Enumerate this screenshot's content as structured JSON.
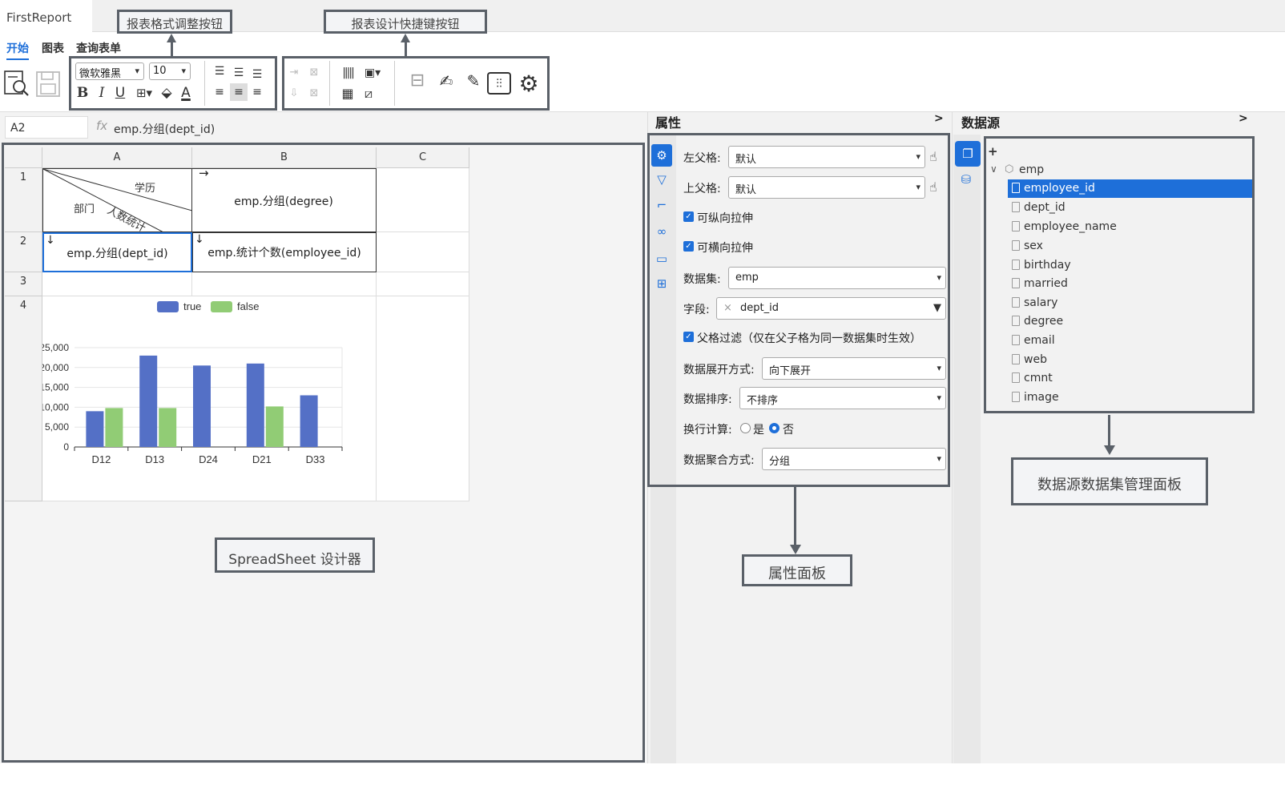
{
  "app": {
    "title": "FirstReport"
  },
  "ribbon": {
    "tabs": [
      {
        "label": "开始"
      },
      {
        "label": "图表"
      },
      {
        "label": "查询表单"
      }
    ],
    "font_family": "微软雅黑",
    "font_size": "10"
  },
  "callouts": {
    "format_buttons": "报表格式调整按钮",
    "design_shortcuts": "报表设计快捷键按钮",
    "spreadsheet_designer": "SpreadSheet 设计器",
    "props_panel": "属性面板",
    "datasource_panel": "数据源数据集管理面板"
  },
  "formula": {
    "cell_ref": "A2",
    "fx": "fx",
    "value": "emp.分组(dept_id)"
  },
  "sheet": {
    "columns": [
      "A",
      "B",
      "C"
    ],
    "rows": [
      "1",
      "2",
      "3",
      "4"
    ],
    "cells": {
      "a1_top": "学历",
      "a1_middle": "人数统计",
      "a1_bottom": "部门",
      "b1": "emp.分组(degree)",
      "b1_marker": "→",
      "a2": "emp.分组(dept_id)",
      "a2_marker": "↓",
      "b2": "emp.统计个数(employee_id)",
      "b2_marker": "↓"
    }
  },
  "chart_data": {
    "type": "bar",
    "categories": [
      "D12",
      "D13",
      "D24",
      "D21",
      "D33"
    ],
    "series": [
      {
        "name": "true",
        "values": [
          9000,
          23000,
          20500,
          21000,
          13000
        ],
        "color": "#5470c6"
      },
      {
        "name": "false",
        "values": [
          9800,
          9800,
          null,
          10200,
          null
        ],
        "color": "#91cc75"
      }
    ],
    "yticks": [
      "0",
      "5,000",
      "10,000",
      "15,000",
      "20,000",
      "25,000"
    ],
    "ylim": [
      0,
      25000
    ],
    "legend": "top-center"
  },
  "props": {
    "title": "属性",
    "collapse": ">",
    "left_parent_label": "左父格:",
    "left_parent_value": "默认",
    "top_parent_label": "上父格:",
    "top_parent_value": "默认",
    "vertical_stretch": "可纵向拉伸",
    "horizontal_stretch": "可横向拉伸",
    "dataset_label": "数据集:",
    "dataset_value": "emp",
    "field_label": "字段:",
    "field_value": "dept_id",
    "parent_filter": "父格过滤（仅在父子格为同一数据集时生效）",
    "expand_label": "数据展开方式:",
    "expand_value": "向下展开",
    "sort_label": "数据排序:",
    "sort_value": "不排序",
    "wrap_calc_label": "换行计算:",
    "wrap_yes": "是",
    "wrap_no": "否",
    "aggregate_label": "数据聚合方式:",
    "aggregate_value": "分组"
  },
  "datasource": {
    "title": "数据源",
    "collapse": ">",
    "add": "+",
    "dataset": "emp",
    "fields": [
      "employee_id",
      "dept_id",
      "employee_name",
      "sex",
      "birthday",
      "married",
      "salary",
      "degree",
      "email",
      "web",
      "cmnt",
      "image"
    ]
  }
}
